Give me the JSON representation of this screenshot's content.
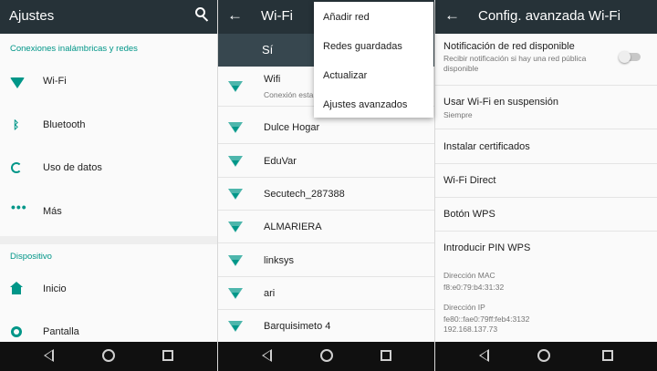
{
  "settings": {
    "title": "Ajustes",
    "section_wireless": "Conexiones inalámbricas y redes",
    "section_device": "Dispositivo",
    "items": [
      {
        "label": "Wi-Fi",
        "icon": "wifi-icon"
      },
      {
        "label": "Bluetooth",
        "icon": "bluetooth-icon"
      },
      {
        "label": "Uso de datos",
        "icon": "data-usage-icon"
      },
      {
        "label": "Más",
        "icon": "more-icon"
      },
      {
        "label": "Inicio",
        "icon": "home-icon"
      },
      {
        "label": "Pantalla",
        "icon": "brightness-icon"
      }
    ]
  },
  "wifi": {
    "title": "Wi-Fi",
    "switch_label": "Sí",
    "connected_network": {
      "name": "Wifi",
      "status": "Conexión esta"
    },
    "networks": [
      "Dulce Hogar",
      "EduVar",
      "Secutech_287388",
      "ALMARIERA",
      "linksys",
      "ari",
      "Barquisimeto 4"
    ],
    "menu": [
      "Añadir red",
      "Redes guardadas",
      "Actualizar",
      "Ajustes avanzados"
    ]
  },
  "advanced": {
    "title": "Config. avanzada Wi-Fi",
    "notification": {
      "title": "Notificación de red disponible",
      "subtitle_line1": "Recibir notificación si hay una red pública",
      "subtitle_line2": "disponible",
      "enabled": false
    },
    "sleep": {
      "title": "Usar Wi-Fi en suspensión",
      "subtitle": "Siempre"
    },
    "install_certs": "Instalar certificados",
    "wifi_direct": "Wi-Fi Direct",
    "wps_button": "Botón WPS",
    "wps_pin": "Introducir PIN WPS",
    "mac_label": "Dirección MAC",
    "mac_value": "f8:e0:79:b4:31:32",
    "ip_label": "Dirección IP",
    "ip_value_v6": "fe80::fae0:79ff:feb4:3132",
    "ip_value_v4": "192.168.137.73"
  },
  "colors": {
    "appbar": "#263238",
    "accent": "#009688",
    "navbar": "#101010"
  }
}
